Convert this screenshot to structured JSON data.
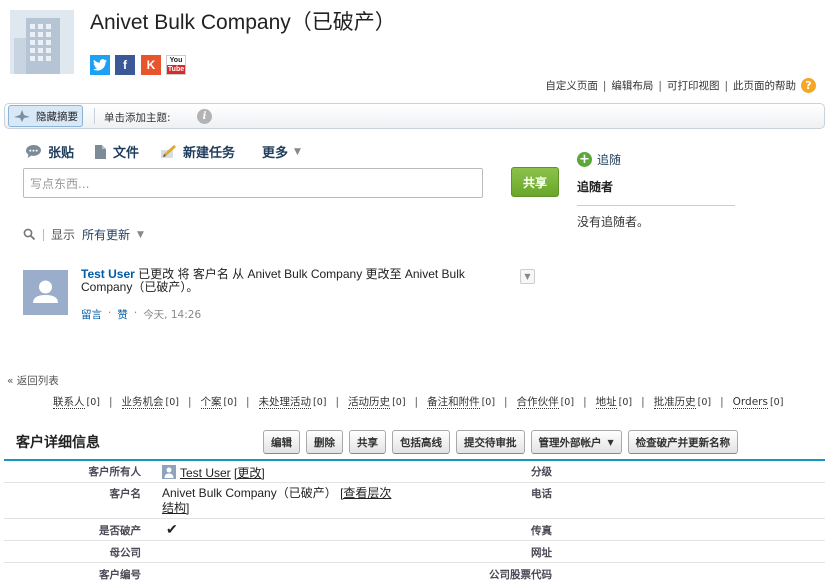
{
  "header": {
    "account_title": "Anivet Bulk Company（已破产）",
    "social": [
      "twitter-icon",
      "facebook-icon",
      "klout-icon",
      "youtube-icon"
    ],
    "youtube_top": "You",
    "youtube_bottom": "Tube",
    "top_links": [
      "自定义页面",
      "编辑布局",
      "可打印视图",
      "此页面的帮助"
    ]
  },
  "chatter_bar": {
    "hide_summary": "隐藏摘要",
    "add_topic": "单击添加主题:"
  },
  "publisher": {
    "tabs": [
      "张贴",
      "文件",
      "新建任务"
    ],
    "more": "更多",
    "placeholder": "写点东西...",
    "share": "共享"
  },
  "follow": {
    "follow_label": "追随",
    "followers_heading": "追随者",
    "no_followers": "没有追随者。"
  },
  "feed_filter": {
    "show": "显示",
    "selected": "所有更新"
  },
  "feed_item": {
    "user": "Test User",
    "text": " 已更改 将 客户名 从 Anivet Bulk Company 更改至 Anivet Bulk Company（已破产）。",
    "comment": "留言",
    "like": "赞",
    "time": "今天, 14:26"
  },
  "related": {
    "back": "« 返回列表",
    "links": [
      {
        "label": "联系人",
        "count": "[0]"
      },
      {
        "label": "业务机会",
        "count": "[0]"
      },
      {
        "label": "个案",
        "count": "[0]"
      },
      {
        "label": "未处理活动",
        "count": "[0]"
      },
      {
        "label": "活动历史",
        "count": "[0]"
      },
      {
        "label": "备注和附件",
        "count": "[0]"
      },
      {
        "label": "合作伙伴",
        "count": "[0]"
      },
      {
        "label": "地址",
        "count": "[0]"
      },
      {
        "label": "批准历史",
        "count": "[0]"
      },
      {
        "label": "Orders",
        "count": "[0]"
      }
    ]
  },
  "detail": {
    "title": "客户详细信息",
    "buttons": [
      "编辑",
      "删除",
      "共享",
      "包括高线",
      "提交待审批",
      "管理外部帐户",
      "检查破产并更新名称"
    ],
    "rows": [
      {
        "label": "客户所有人",
        "value": "Test User",
        "action": "[更改]",
        "right_label": "分级"
      },
      {
        "label": "客户名",
        "value": "Anivet Bulk Company（已破产）",
        "action": "[查看层次结构]",
        "right_label": "电话"
      },
      {
        "label": "是否破产",
        "value": "✔",
        "right_label": "传真"
      },
      {
        "label": "母公司",
        "value": "",
        "right_label": "网址"
      },
      {
        "label": "客户编号",
        "value": "",
        "right_label": "公司股票代码"
      }
    ]
  }
}
